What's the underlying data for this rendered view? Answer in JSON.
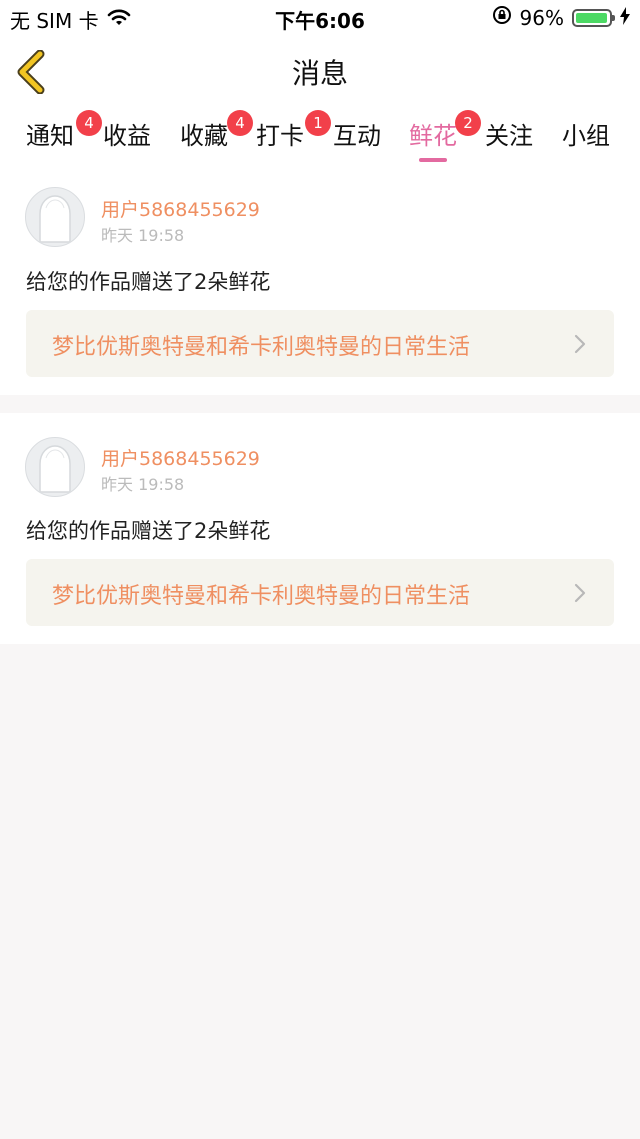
{
  "status_bar": {
    "carrier": "无 SIM 卡",
    "time": "下午6:06",
    "battery_percent": "96%",
    "battery_level": 0.96,
    "icons": [
      "wifi-icon",
      "rotation-lock-icon",
      "battery-icon",
      "charging-icon"
    ]
  },
  "nav": {
    "title": "消息",
    "back_icon": "chevron-left-icon",
    "back_color": "#f2c522"
  },
  "tabs": [
    {
      "label": "通知",
      "badge": "4"
    },
    {
      "label": "收益",
      "badge": ""
    },
    {
      "label": "收藏",
      "badge": "4"
    },
    {
      "label": "打卡",
      "badge": "1"
    },
    {
      "label": "互动",
      "badge": ""
    },
    {
      "label": "鲜花",
      "badge": "2",
      "active": true
    },
    {
      "label": "关注",
      "badge": ""
    },
    {
      "label": "小组",
      "badge": ""
    }
  ],
  "messages": [
    {
      "username": "用户5868455629",
      "time": "昨天 19:58",
      "text": "给您的作品赠送了2朵鲜花",
      "work_title": "梦比优斯奥特曼和希卡利奥特曼的日常生活"
    },
    {
      "username": "用户5868455629",
      "time": "昨天 19:58",
      "text": "给您的作品赠送了2朵鲜花",
      "work_title": "梦比优斯奥特曼和希卡利奥特曼的日常生活"
    }
  ],
  "colors": {
    "accent_pink": "#e36aa0",
    "username_orange": "#ef8f61",
    "badge_red": "#f2404a",
    "battery_green": "#4cd964"
  }
}
